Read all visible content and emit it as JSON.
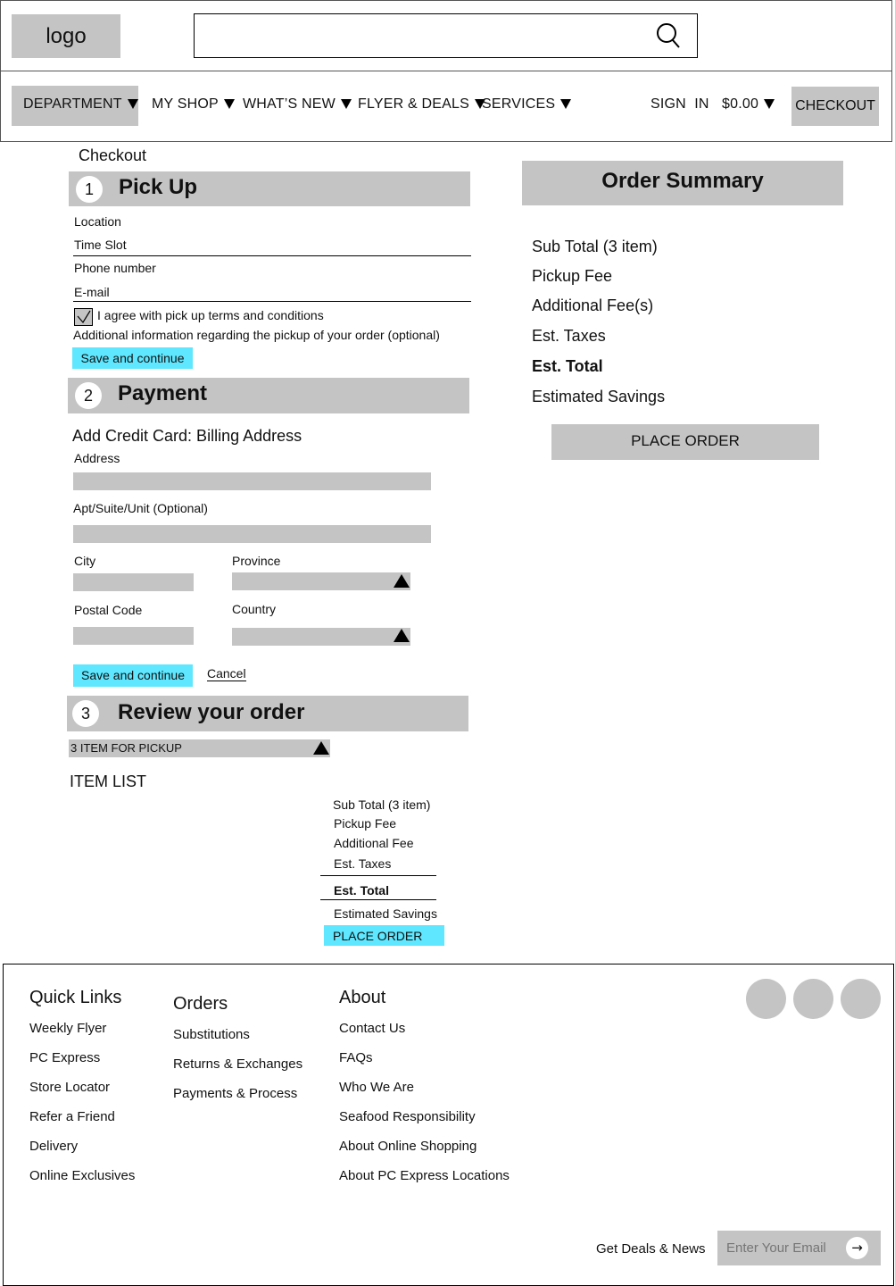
{
  "header": {
    "logo": "logo",
    "search": {
      "value": "",
      "placeholder": "",
      "icon": "search-icon"
    }
  },
  "nav": {
    "department": "DEPARTMENT",
    "my_shop": "MY SHOP",
    "whats_new": "WHAT’S NEW",
    "flyer_deals": "FLYER & DEALS",
    "services": "SERVICES",
    "sign_in": "SIGN  IN",
    "cart_total": "$0.00",
    "checkout": "CHECKOUT"
  },
  "page": {
    "title": "Checkout"
  },
  "pickup": {
    "step": "1",
    "title": "Pick Up",
    "location_label": "Location",
    "time_slot_label": "Time Slot",
    "phone_label": "Phone number",
    "email_label": "E-mail",
    "agree_label": "I agree with pick up terms and conditions",
    "agree_checked": true,
    "additional_info": "Additional information regarding the pickup of your order (optional)",
    "save_button": "Save and continue"
  },
  "payment": {
    "step": "2",
    "title": "Payment",
    "subtitle": "Add Credit Card: Billing Address",
    "address_label": "Address",
    "apt_label": "Apt/Suite/Unit (Optional)",
    "city_label": "City",
    "province_label": "Province",
    "postal_label": "Postal Code",
    "country_label": "Country",
    "save_button": "Save and continue",
    "cancel_link": "Cancel"
  },
  "review": {
    "step": "3",
    "title": "Review your order",
    "pickup_dropdown": "3 ITEM FOR PICKUP",
    "item_list": "ITEM LIST",
    "summary": {
      "subtotal": "Sub Total (3 item)",
      "pickup_fee": "Pickup Fee",
      "additional_fee": "Additional Fee",
      "taxes": "Est. Taxes",
      "total": "Est. Total",
      "savings": "Estimated Savings",
      "place_order": "PLACE ORDER"
    }
  },
  "order_summary": {
    "title": "Order Summary",
    "subtotal": "Sub Total (3 item)",
    "pickup_fee": "Pickup Fee",
    "additional_fees": "Additional Fee(s)",
    "taxes": "Est. Taxes",
    "total": "Est. Total",
    "savings": "Estimated Savings",
    "place_order": "PLACE ORDER"
  },
  "footer": {
    "quick_links": {
      "title": "Quick Links",
      "items": [
        "Weekly Flyer",
        "PC Express",
        "Store Locator",
        "Refer a Friend",
        "Delivery",
        "Online Exclusives"
      ]
    },
    "orders": {
      "title": "Orders",
      "items": [
        "Substitutions",
        "Returns & Exchanges",
        "Payments & Process"
      ]
    },
    "about": {
      "title": "About",
      "items": [
        "Contact Us",
        "FAQs",
        "Who We Are",
        "Seafood Responsibility",
        "About Online Shopping",
        "About PC Express Locations"
      ]
    },
    "newsletter": {
      "label": "Get Deals & News",
      "placeholder": "Enter Your Email",
      "submit_icon": "arrow-right-icon"
    }
  },
  "colors": {
    "gray": "#c4c4c4",
    "accent": "#5ee7ff"
  }
}
